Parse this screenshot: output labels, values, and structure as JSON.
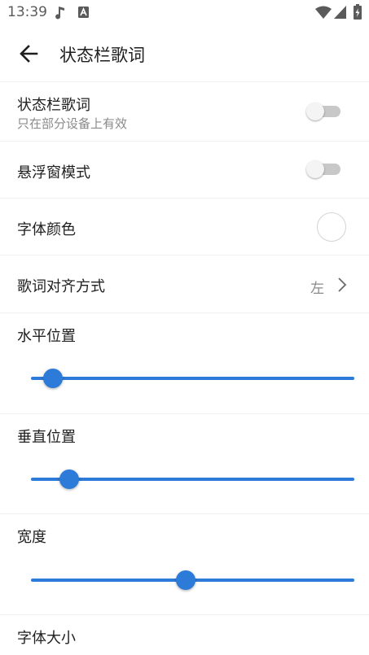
{
  "status_bar": {
    "time": "13:39",
    "icons": [
      "music-note-icon",
      "a-box-icon",
      "wifi-icon",
      "signal-icon",
      "battery-charging-icon"
    ]
  },
  "app_bar": {
    "back_icon": "arrow-back-icon",
    "title": "状态栏歌词"
  },
  "colors": {
    "accent": "#2d7bd8",
    "switch_track_off": "#c8c8c8",
    "divider": "#f0f0f0",
    "secondary_text": "#8a8a8a"
  },
  "settings": {
    "statusbar_lyric": {
      "title": "状态栏歌词",
      "subtitle": "只在部分设备上有效",
      "enabled": false
    },
    "floating_window": {
      "title": "悬浮窗模式",
      "enabled": false
    },
    "font_color": {
      "title": "字体颜色",
      "value_color": "#ffffff"
    },
    "alignment": {
      "title": "歌词对齐方式",
      "value": "左"
    },
    "horizontal_position": {
      "title": "水平位置",
      "value_fraction": 0.06
    },
    "vertical_position": {
      "title": "垂直位置",
      "value_fraction": 0.11
    },
    "width": {
      "title": "宽度",
      "value_fraction": 0.47
    },
    "font_size": {
      "title": "字体大小"
    }
  }
}
